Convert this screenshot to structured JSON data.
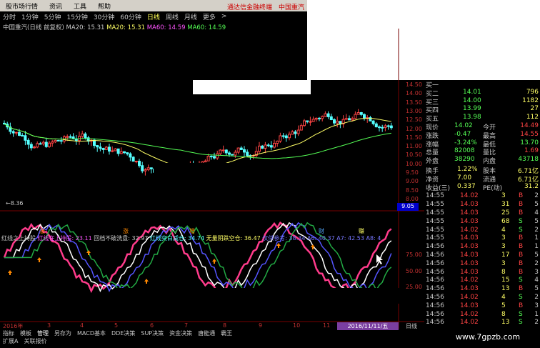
{
  "menu": {
    "items": [
      "股市场行情",
      "资讯",
      "工具",
      "帮助"
    ],
    "brand": "通达信金融终端",
    "stock": "中国重汽"
  },
  "periods": [
    "分时",
    "1分钟",
    "5分钟",
    "15分钟",
    "30分钟",
    "60分钟",
    "日线",
    "周线",
    "月线",
    "更多",
    ">"
  ],
  "active_period": "日线",
  "indicator_line": {
    "name": "中国重汽(日线 前复权)",
    "ma20a": "MA20: 15.31",
    "ma20b": "MA20: 15.31",
    "ma60a": "MA60: 14.59",
    "ma60b": "MA60: 14.59"
  },
  "price_axis": [
    "14.50",
    "14.00",
    "13.50",
    "13.00",
    "12.50",
    "12.00",
    "11.50",
    "11.00",
    "10.50",
    "10.00",
    "9.50",
    "9.00",
    "8.50",
    "8.00"
  ],
  "low_label": "8.36",
  "price_tag": "9.05",
  "lower_indicator": {
    "t1": "红线之上持股",
    "t2": "红线在上持股: 23.11",
    "t3": "回档不破洗盘: 32.97",
    "t4": "红线突白减仓: 34.74",
    "t5": "无量阴跌空仓: 36.47",
    "t6": "仅供参考: 38.34",
    "t7": "A6: 40.37",
    "t8": "A7: 42.53",
    "t9": "A8: 4"
  },
  "lower_axis": [
    "75.00",
    "50.00",
    "25.00"
  ],
  "signal_labels": [
    "涨",
    "涨",
    "增",
    "财",
    "赚"
  ],
  "x_axis": [
    "2016年",
    "3",
    "4",
    "5",
    "6",
    "7",
    "8",
    "9",
    "10",
    "11"
  ],
  "date_box": "2016/11/11/五",
  "daily_label": "日线",
  "quote": {
    "bids": [
      {
        "label": "买一",
        "price": "",
        "vol": ""
      },
      {
        "label": "买二",
        "price": "14.01",
        "vol": "796"
      },
      {
        "label": "买三",
        "price": "14.00",
        "vol": "1182"
      },
      {
        "label": "买四",
        "price": "13.99",
        "vol": "27"
      },
      {
        "label": "买五",
        "price": "13.98",
        "vol": "112"
      }
    ],
    "stats": [
      {
        "l1": "现价",
        "v1": "14.02",
        "l2": "今开",
        "v2": "14.49"
      },
      {
        "l1": "涨跌",
        "v1": "-0.47",
        "l2": "最高",
        "v2": "14.55"
      },
      {
        "l1": "涨幅",
        "v1": "-3.24%",
        "l2": "最低",
        "v2": "13.70"
      },
      {
        "l1": "总量",
        "v1": "82008",
        "l2": "量比",
        "v2": "1.69"
      },
      {
        "l1": "外盘",
        "v1": "38290",
        "l2": "内盘",
        "v2": "43718"
      }
    ],
    "fund": [
      {
        "l1": "换手",
        "v1": "1.22%",
        "l2": "股本",
        "v2": "6.71亿"
      },
      {
        "l1": "净资",
        "v1": "7.00",
        "l2": "流通",
        "v2": "6.71亿"
      },
      {
        "l1": "收益(三)",
        "v1": "0.337",
        "l2": "PE(动)",
        "v2": "31.2"
      }
    ]
  },
  "ticks": [
    {
      "t": "14:55",
      "p": "14.02",
      "v": "3",
      "f": "B",
      "n": "2"
    },
    {
      "t": "14:55",
      "p": "14.03",
      "v": "31",
      "f": "B",
      "n": "5"
    },
    {
      "t": "14:55",
      "p": "14.03",
      "v": "25",
      "f": "B",
      "n": "4"
    },
    {
      "t": "14:55",
      "p": "14.03",
      "v": "68",
      "f": "S",
      "n": "5"
    },
    {
      "t": "14:55",
      "p": "14.02",
      "v": "4",
      "f": "S",
      "n": "2"
    },
    {
      "t": "14:55",
      "p": "14.03",
      "v": "3",
      "f": "B",
      "n": "1"
    },
    {
      "t": "14:56",
      "p": "14.03",
      "v": "3",
      "f": "B",
      "n": "1"
    },
    {
      "t": "14:56",
      "p": "14.03",
      "v": "17",
      "f": "B",
      "n": "5"
    },
    {
      "t": "14:56",
      "p": "14.03",
      "v": "3",
      "f": "B",
      "n": "2"
    },
    {
      "t": "14:56",
      "p": "14.03",
      "v": "8",
      "f": "B",
      "n": "3"
    },
    {
      "t": "14:56",
      "p": "14.02",
      "v": "15",
      "f": "S",
      "n": "4"
    },
    {
      "t": "14:56",
      "p": "14.03",
      "v": "13",
      "f": "B",
      "n": "5"
    },
    {
      "t": "14:56",
      "p": "14.02",
      "v": "4",
      "f": "S",
      "n": "2"
    },
    {
      "t": "14:56",
      "p": "14.03",
      "v": "5",
      "f": "B",
      "n": "3"
    },
    {
      "t": "14:56",
      "p": "14.02",
      "v": "8",
      "f": "S",
      "n": "1"
    },
    {
      "t": "14:56",
      "p": "14.02",
      "v": "13",
      "f": "S",
      "n": "2"
    }
  ],
  "tabs": [
    "指标",
    "模板",
    "管理",
    "另存为",
    "MACD基本",
    "DDE决策",
    "SUP决策",
    "资金决策",
    "唐能通",
    "霸王"
  ],
  "active_tab": "管理",
  "status": [
    "扩展A",
    "关联报价"
  ],
  "website": "www.7gpzb.com",
  "colors": {
    "up": "#ff4444",
    "down": "#55ffff",
    "ma_fast": "#ffff66",
    "ma_slow": "#55ff55",
    "panel_bg": "#000000"
  }
}
